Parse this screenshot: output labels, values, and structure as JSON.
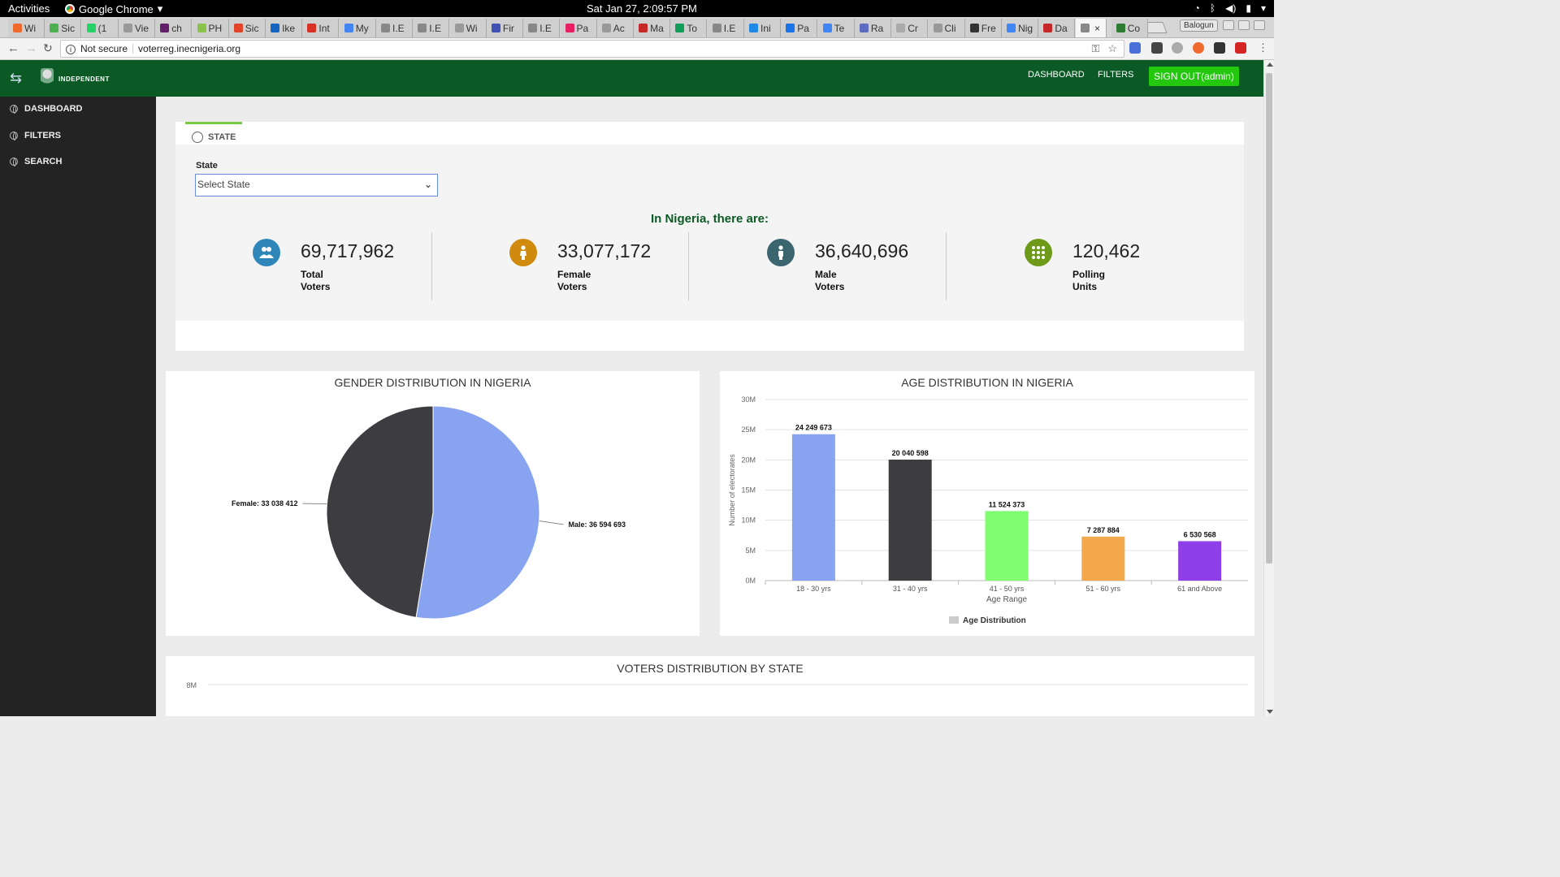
{
  "system": {
    "activities": "Activities",
    "app_name": "Google Chrome",
    "clock": "Sat Jan 27,  2:09:57 PM"
  },
  "browser": {
    "tabs": [
      "Wi",
      "Sic",
      "(1",
      "Vie",
      "ch",
      "PH",
      "Sic",
      "Ike",
      "Int",
      "My",
      "I.E",
      "I.E",
      "Wi",
      "Fir",
      "I.E",
      "Pa",
      "Ac",
      "Ma",
      "To",
      "I.E",
      "Ini",
      "Pa",
      "Te",
      "Ra",
      "Cr",
      "Cli",
      "Fre",
      "Nig",
      "Da",
      "",
      "Co"
    ],
    "profile": "Balogun",
    "security": "Not secure",
    "url": "voterreg.inecnigeria.org"
  },
  "header": {
    "logo_text": "INDEPENDENT",
    "nav": [
      "DASHBOARD",
      "FILTERS"
    ],
    "signout": "SIGN OUT(admin)"
  },
  "sidebar": {
    "items": [
      {
        "label": "DASHBOARD",
        "icon": "globe-icon"
      },
      {
        "label": "FILTERS",
        "icon": "globe-icon"
      },
      {
        "label": "SEARCH",
        "icon": "globe-icon"
      }
    ]
  },
  "state_panel": {
    "tab": "STATE",
    "label": "State",
    "select_value": "Select State",
    "headline": "In Nigeria, there are:",
    "stats": [
      {
        "value": "69,717,962",
        "label1": "Total",
        "label2": "Voters",
        "color": "#2f86b8",
        "icon": "users-icon"
      },
      {
        "value": "33,077,172",
        "label1": "Female",
        "label2": "Voters",
        "color": "#d08a0e",
        "icon": "female-icon"
      },
      {
        "value": "36,640,696",
        "label1": "Male",
        "label2": "Voters",
        "color": "#3b6670",
        "icon": "male-icon"
      },
      {
        "value": "120,462",
        "label1": "Polling",
        "label2": "Units",
        "color": "#6e9a1a",
        "icon": "grid-icon"
      }
    ]
  },
  "chart_data": [
    {
      "type": "pie",
      "title": "GENDER DISTRIBUTION IN NIGERIA",
      "slices": [
        {
          "label": "Male",
          "value": 36594693,
          "display": "Male: 36 594 693",
          "color": "#88a4f0"
        },
        {
          "label": "Female",
          "value": 33038412,
          "display": "Female: 33 038 412",
          "color": "#3c3c41"
        }
      ]
    },
    {
      "type": "bar",
      "title": "AGE DISTRIBUTION IN NIGERIA",
      "xlabel": "Age Range",
      "ylabel": "Number of electorates",
      "categories": [
        "18 - 30 yrs",
        "31 - 40 yrs",
        "41 - 50 yrs",
        "51 - 60 yrs",
        "61 and Above"
      ],
      "values": [
        24249673,
        20040598,
        11524373,
        7287884,
        6530568
      ],
      "value_labels": [
        "24 249 673",
        "20 040 598",
        "11 524 373",
        "7 287 884",
        "6 530 568"
      ],
      "colors": [
        "#88a4f0",
        "#3c3c41",
        "#80fd70",
        "#f4a84c",
        "#8e3fe8"
      ],
      "yticks": [
        "0M",
        "5M",
        "10M",
        "15M",
        "20M",
        "25M",
        "30M"
      ],
      "ylim": [
        0,
        30000000
      ],
      "grid": true,
      "legend": "Age Distribution",
      "legend_position": "bottom"
    },
    {
      "type": "bar",
      "title": "VOTERS DISTRIBUTION BY STATE",
      "yticks": [
        "8M"
      ]
    }
  ]
}
